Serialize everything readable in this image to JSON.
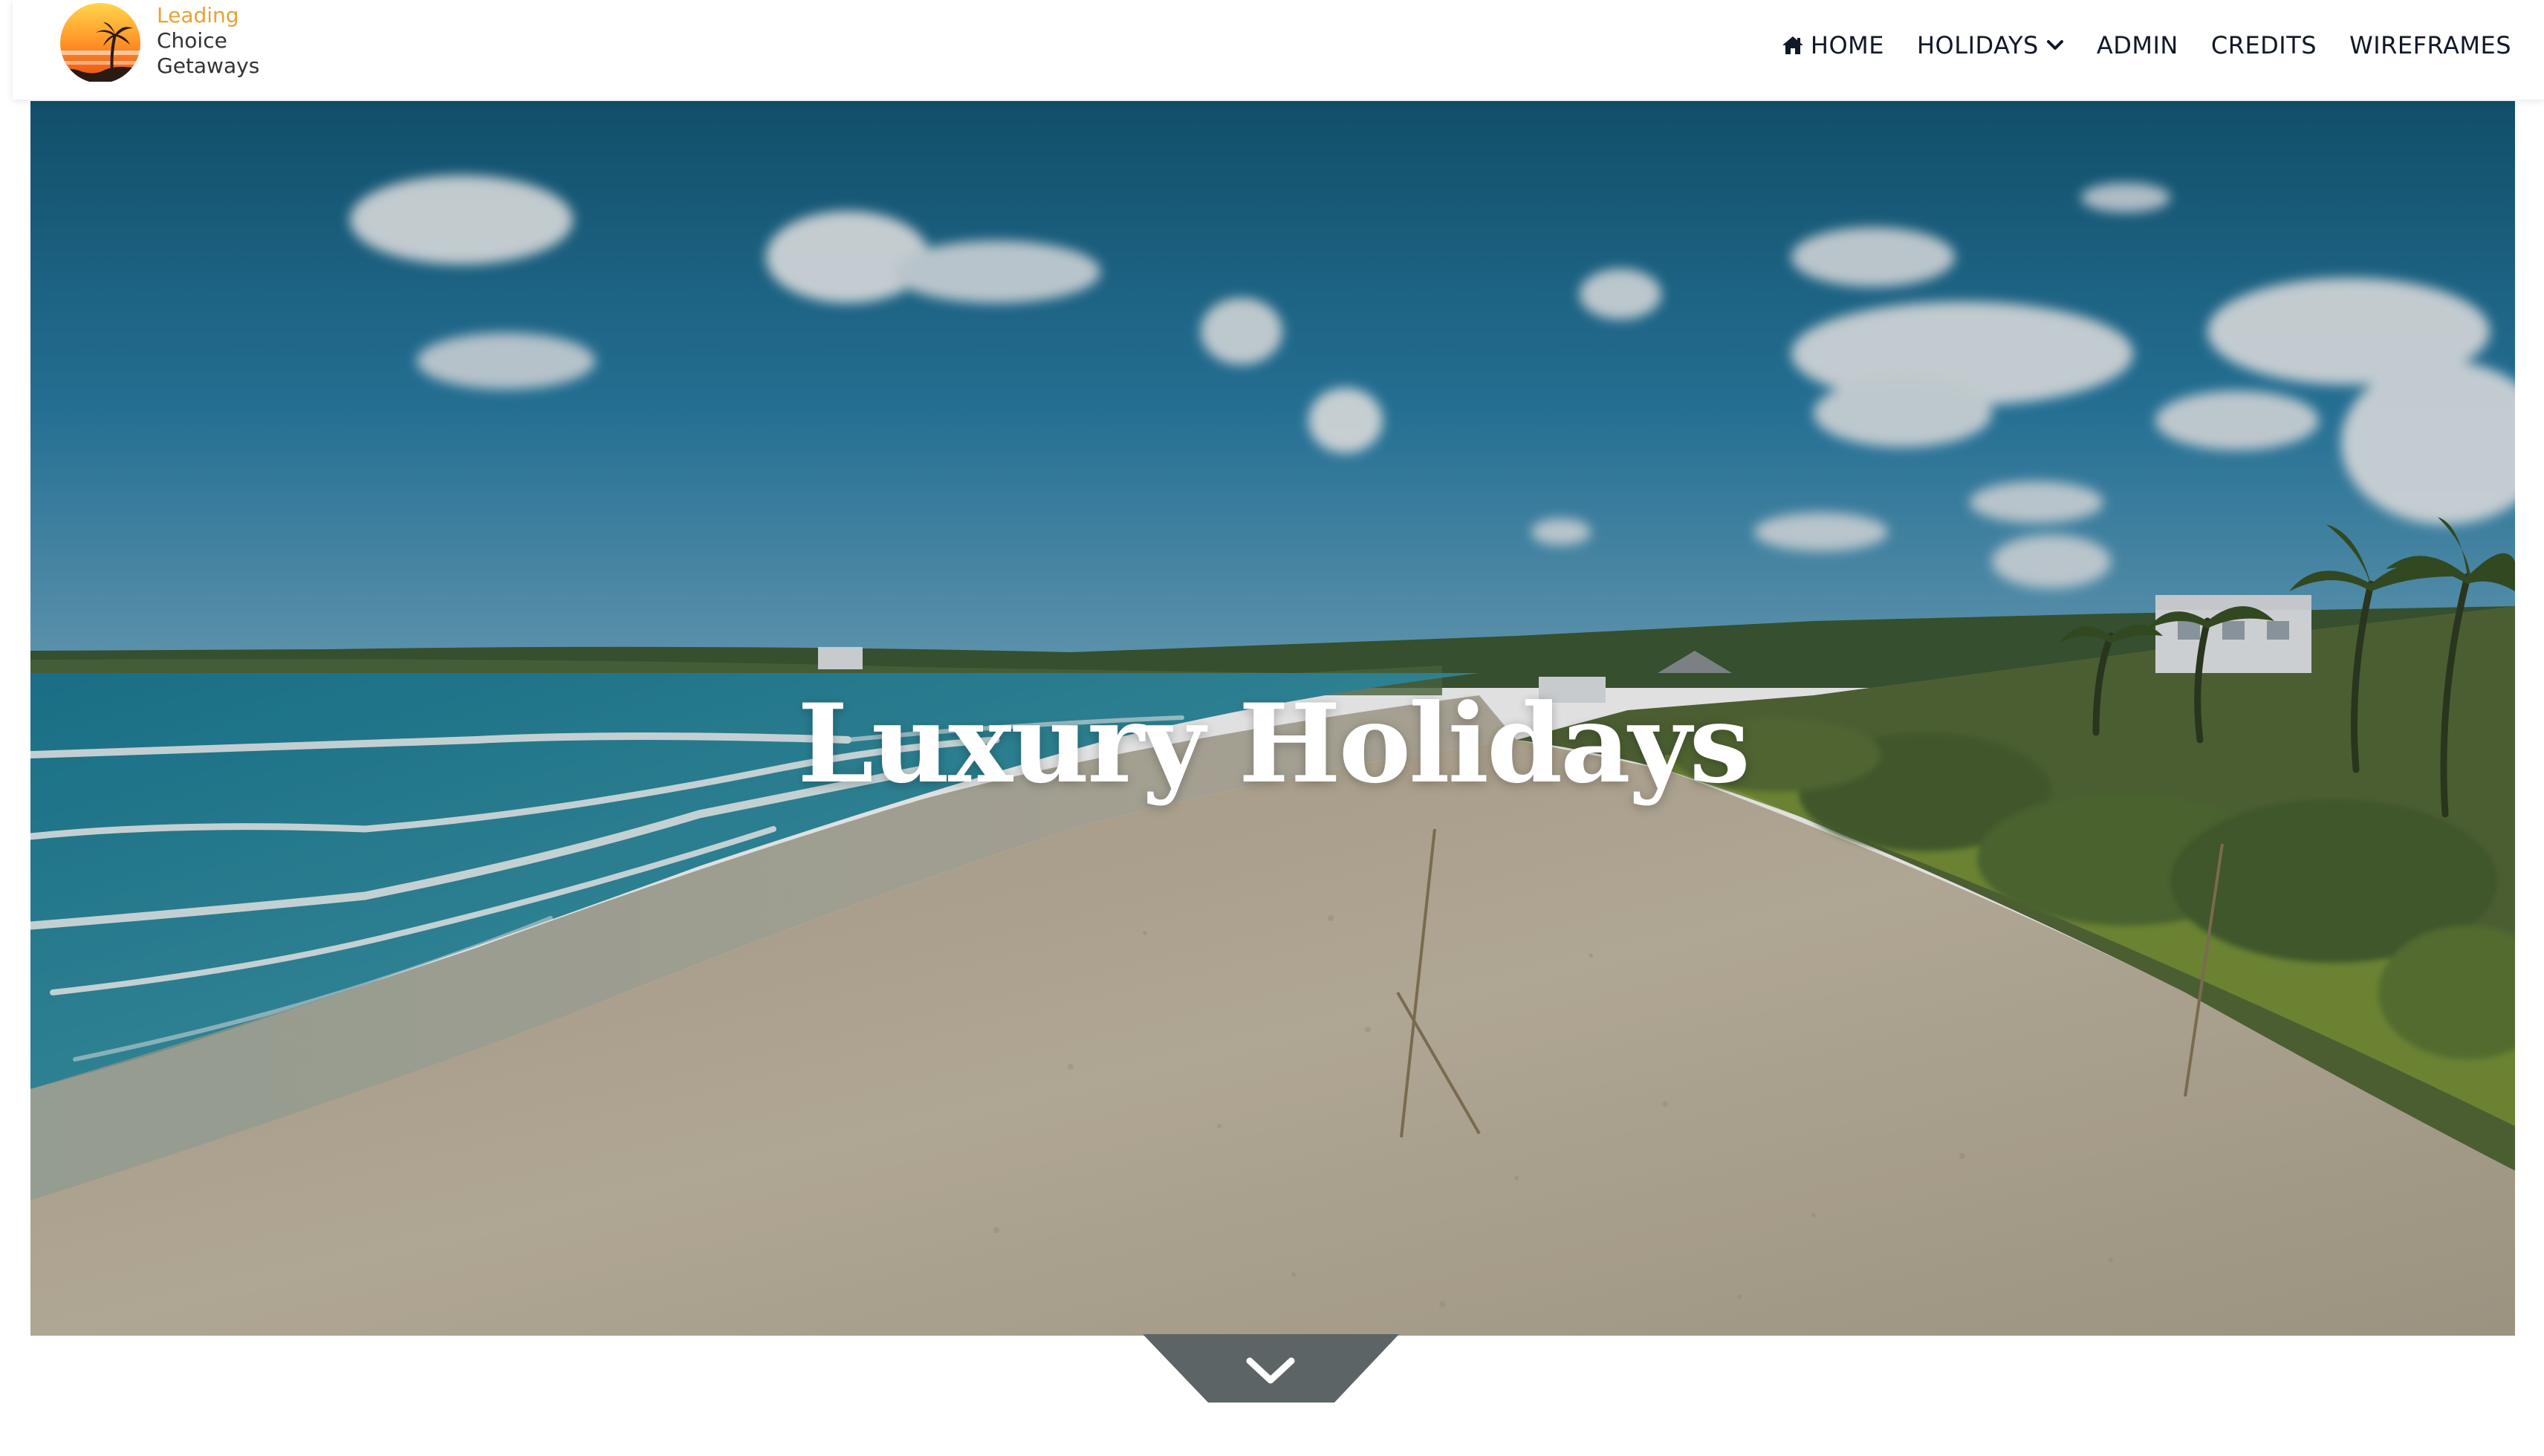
{
  "brand": {
    "line1": "Leading",
    "line2": "Choice",
    "line3": "Getaways",
    "logo_icon": "sunset-palm-logo"
  },
  "nav": {
    "items": [
      {
        "label": "HOME",
        "icon": "home-icon"
      },
      {
        "label": "HOLIDAYS",
        "icon": "chevron-down-icon"
      },
      {
        "label": "ADMIN"
      },
      {
        "label": "CREDITS"
      },
      {
        "label": "WIREFRAMES"
      }
    ]
  },
  "hero": {
    "title": "Luxury Holidays",
    "background": "tropical beach aerial"
  },
  "scroll": {
    "icon": "chevron-down-icon"
  },
  "colors": {
    "brand_accent": "#e8a235",
    "nav_text": "#111827",
    "hero_text": "#ffffff",
    "sky": "#1f6f99",
    "sea": "#2a8ea6",
    "sand": "#c9bda6"
  }
}
